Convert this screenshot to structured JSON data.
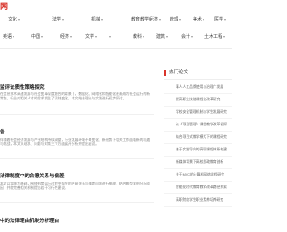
{
  "site": {
    "logo_text": "网"
  },
  "nav": {
    "row1": [
      "文化",
      "法学",
      "机械",
      "教育教学",
      "经济",
      "管理",
      "美术",
      "医学"
    ],
    "row2": [
      "英语",
      "中国",
      "经济",
      "文学",
      "",
      "教科",
      "建筑",
      "会计",
      "土木工程"
    ]
  },
  "articles": [
    {
      "title": "监评论质性策略探究",
      "body": "在信息技术高速发展与社会变革深度融合的背景下，数据化、网络化和智能化逐渐成为社会运行的新常态，行业对相关人才的需求发生了深刻变化，本文结合理论与实践进行初步探讨。"
    },
    {
      "title": "告",
      "body": "伴随着社会经济发展与产业结构持续调整，行业发展环境不断变化，新形势下相关工作面临新的机遇与挑战，本文从现状、问题与对策三个方面展开分析并提出建议。"
    },
    {
      "title": "法律制度中的合意关系与偏差",
      "body": "本文以实践为基础，围绕制度运行过程中存在的合意关系与偏差问题进行梳理，结合典型案例分析成因，并就完善相关机制提出若干可行性建议。"
    },
    {
      "title": "中的法律理由机制分析理由",
      "body": ""
    }
  ],
  "sidebar": {
    "title": "热门论文",
    "items": [
      "事人人工品牌使用与治理广发展",
      "提高职业技能课程化改革研究",
      "学校安全管理机制与学生发展研究",
      "论《项目管理》课程教学改革初探",
      "结合项目式教学模式下的课程研究",
      "基于实践导向的高职课程体系构建",
      "新媒体背景下高校思政教育创新",
      "关于MVC的计算机网络课程研究",
      "智能化时代教育教学改革路径探索",
      "高职院校学生职业素养培养研究"
    ]
  }
}
